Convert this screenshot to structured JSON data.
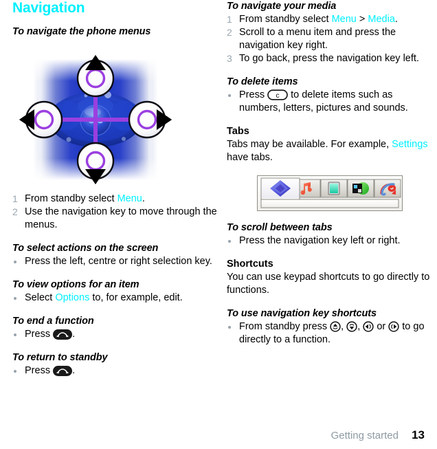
{
  "chapter": {
    "title": "Navigation"
  },
  "footer": {
    "breadcrumb": "Getting started",
    "page_number": "13"
  },
  "colors": {
    "link": "#00f0ff",
    "heading": "#00f0ff",
    "list_marker": "#9aa7b0",
    "bullet": "#97a3ad",
    "footer_text": "#8d9aa3"
  },
  "left": {
    "proc1": {
      "title": "To navigate the phone menus",
      "illustration_name": "navigation-key-illustration",
      "steps": [
        {
          "num": "1",
          "pre": "From standby select ",
          "link": "Menu",
          "post": "."
        },
        {
          "num": "2",
          "pre": "Use the navigation key to move through the menus.",
          "link": "",
          "post": ""
        }
      ]
    },
    "proc2": {
      "title": "To select actions on the screen",
      "bullets": [
        {
          "pre": "Press the left, centre or right selection key.",
          "link": "",
          "post": ""
        }
      ]
    },
    "proc3": {
      "title": "To view options for an item",
      "bullets": [
        {
          "pre": "Select ",
          "link": "Options",
          "post": " to, for example, edit."
        }
      ]
    },
    "proc4": {
      "title": "To end a function",
      "bullet_pre": "Press ",
      "bullet_key": "end-call-key",
      "bullet_post": "."
    },
    "proc5": {
      "title": "To return to standby",
      "bullet_pre": "Press ",
      "bullet_key": "end-call-key",
      "bullet_post": "."
    }
  },
  "right": {
    "proc1": {
      "title": "To navigate your media",
      "steps": [
        {
          "num": "1",
          "pre": "From standby select ",
          "link": "Menu",
          "mid": " > ",
          "link2": "Media",
          "post": "."
        },
        {
          "num": "2",
          "pre": "Scroll to a menu item and press the navigation key right.",
          "link": "",
          "post": ""
        },
        {
          "num": "3",
          "pre": "To go back, press the navigation key left.",
          "link": "",
          "post": ""
        }
      ]
    },
    "proc2": {
      "title": "To delete items",
      "bullet_pre": "Press ",
      "bullet_key": "clear-key",
      "bullet_key_label": "c",
      "bullet_post": " to delete items such as numbers, letters, pictures and sounds."
    },
    "section_tabs": {
      "title": "Tabs",
      "body_pre": "Tabs may be available. For example, ",
      "body_link": "Settings",
      "body_post": " have tabs.",
      "illustration_name": "tabs-illustration",
      "tabs": [
        {
          "name": "tab-home",
          "icon": "diamond-icon",
          "active": true
        },
        {
          "name": "tab-music",
          "icon": "music-note-icon",
          "active": false
        },
        {
          "name": "tab-pictures",
          "icon": "picture-icon",
          "active": false
        },
        {
          "name": "tab-video",
          "icon": "video-icon",
          "active": false
        },
        {
          "name": "tab-other",
          "icon": "swirl-icon",
          "active": false
        }
      ]
    },
    "proc3": {
      "title": "To scroll between tabs",
      "bullets": [
        {
          "pre": "Press the navigation key left or right.",
          "link": "",
          "post": ""
        }
      ]
    },
    "section_shortcuts": {
      "title": "Shortcuts",
      "body": "You can use keypad shortcuts to go directly to functions."
    },
    "proc4": {
      "title": "To use navigation key shortcuts",
      "bullet_pre": "From standby press ",
      "keys": [
        "nav-up-key",
        "nav-down-key",
        "nav-left-key",
        "nav-right-key"
      ],
      "sep1": ", ",
      "sep2": ", ",
      "sep3": " or ",
      "bullet_post": " to go directly to a function."
    }
  }
}
